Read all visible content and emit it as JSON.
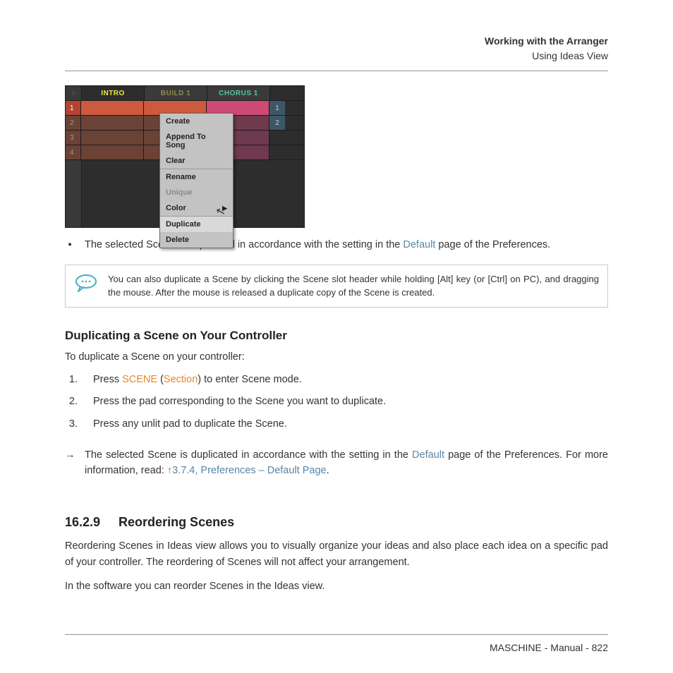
{
  "header": {
    "title": "Working with the Arranger",
    "subtitle": "Using Ideas View"
  },
  "shot": {
    "tabs": {
      "intro": "INTRO",
      "build": "BUILD 1",
      "chorus": "CHORUS 1"
    },
    "rows": [
      "1",
      "2",
      "3",
      "4"
    ],
    "side": [
      "1",
      "2"
    ],
    "menu": {
      "create": "Create",
      "append": "Append To Song",
      "clear": "Clear",
      "rename": "Rename",
      "unique": "Unique",
      "color": "Color",
      "duplicate": "Duplicate",
      "delete": "Delete"
    }
  },
  "bullet1_a": "The selected Scene is duplicated in accordance with the setting in the ",
  "bullet1_link": "Default",
  "bullet1_b": " page of the Preferences.",
  "tip": "You can also duplicate a Scene by clicking the Scene slot header while holding [Alt] key (or [Ctrl] on PC), and dragging the mouse. After the mouse is released a duplicate copy of the Scene is created.",
  "h_dup": "Duplicating a Scene on Your Controller",
  "p_dup_intro": "To duplicate a Scene on your controller:",
  "steps": {
    "s1_a": "Press ",
    "s1_scene": "SCENE",
    "s1_b": " (",
    "s1_section": "Section",
    "s1_c": ") to enter Scene mode.",
    "s2": "Press the pad corresponding to the Scene you want to duplicate.",
    "s3": "Press any unlit pad to duplicate the Scene."
  },
  "result_a": "The selected Scene is duplicated in accordance with the setting in the ",
  "result_link1": "Default",
  "result_b": " page of the Preferences. For more information, read: ",
  "result_link2": "↑3.7.4, Preferences – Default Page",
  "result_c": ".",
  "sub_num": "16.2.9",
  "sub_title": "Reordering Scenes",
  "p_reorder1": "Reordering Scenes in Ideas view allows you to visually organize your ideas and also place each idea on a specific pad of your controller. The reordering of Scenes will not affect your arrangement.",
  "p_reorder2": "In the software you can reorder Scenes in the Ideas view.",
  "footer": "MASCHINE - Manual - 822"
}
